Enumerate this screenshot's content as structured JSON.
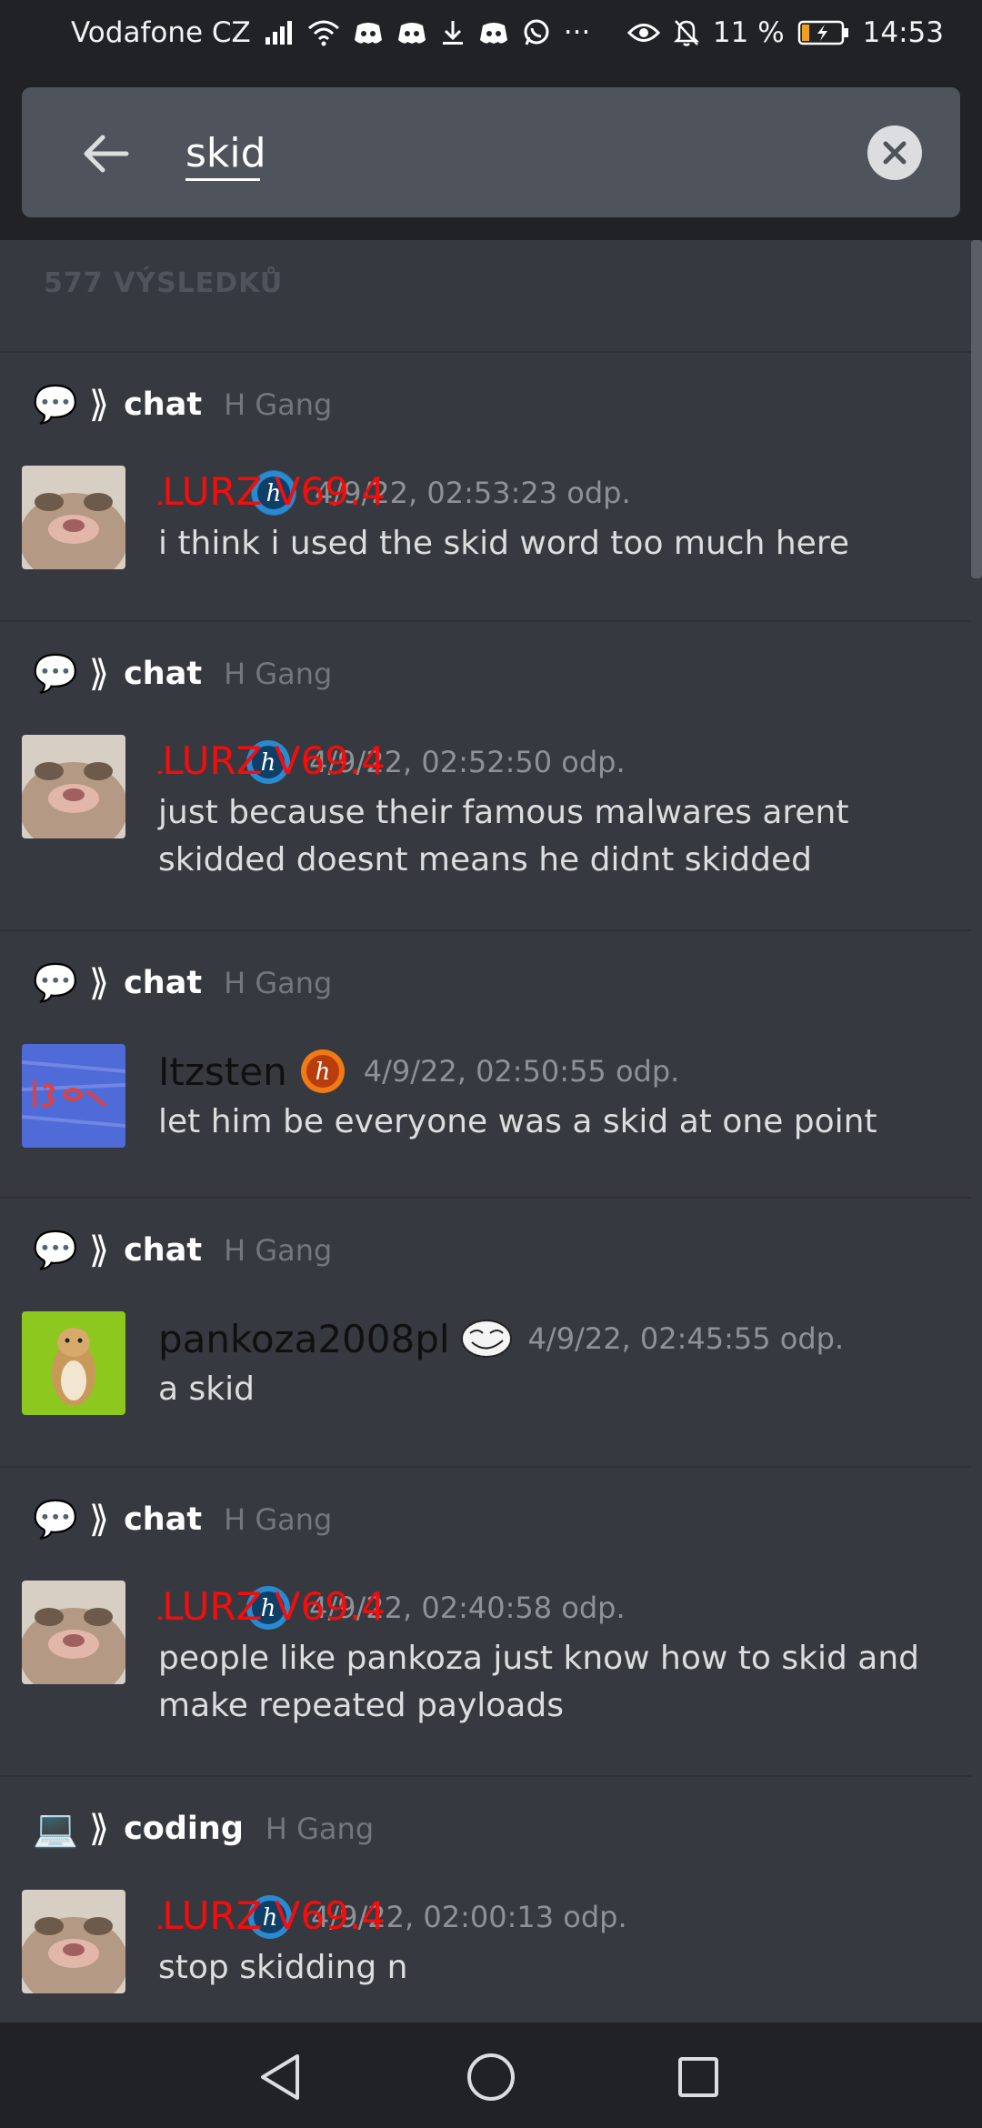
{
  "status_bar": {
    "carrier": "Vodafone CZ",
    "dots": "···",
    "battery_percent": "11 %",
    "time": "14:53",
    "icons": [
      "signal-icon",
      "wifi-icon",
      "discord-icon",
      "discord-icon",
      "download-icon",
      "discord-icon",
      "whatsapp-icon",
      "eye-icon",
      "bell-off-icon",
      "battery-icon"
    ]
  },
  "search": {
    "query": "skid",
    "back_icon": "arrow-left-icon",
    "clear_icon": "close-icon"
  },
  "results": {
    "count_label": "577 VÝSLEDKŮ",
    "items": [
      {
        "channel_emoji": "💬",
        "channel_arrow": "⟫",
        "channel": "chat",
        "guild": "H Gang",
        "author": "OT KILLURZ V69.4",
        "author_color": "#f30d0d",
        "badge": "h-badge-icon",
        "timestamp": "4/9/22, 02:53:23 odp.",
        "text": "i think i used the skid word too much here"
      },
      {
        "channel_emoji": "💬",
        "channel_arrow": "⟫",
        "channel": "chat",
        "guild": "H Gang",
        "author": "OT KILLURZ V69.4",
        "author_color": "#f30d0d",
        "badge": "h-badge-icon",
        "timestamp": "4/9/22, 02:52:50 odp.",
        "text": "just because their famous malwares arent skidded doesnt means he didnt skidded"
      },
      {
        "channel_emoji": "💬",
        "channel_arrow": "⟫",
        "channel": "chat",
        "guild": "H Gang",
        "author": "Itzsten",
        "author_color": "#101010",
        "badge": "h-badge-orange-icon",
        "timestamp": "4/9/22, 02:50:55 odp.",
        "text": "let him be everyone was a skid at one point"
      },
      {
        "channel_emoji": "💬",
        "channel_arrow": "⟫",
        "channel": "chat",
        "guild": "H Gang",
        "author": "pankoza2008pl",
        "author_color": "#101010",
        "badge": "trollface-badge-icon",
        "timestamp": "4/9/22, 02:45:55 odp.",
        "text": "a skid"
      },
      {
        "channel_emoji": "💬",
        "channel_arrow": "⟫",
        "channel": "chat",
        "guild": "H Gang",
        "author": "OT KILLURZ V69.4",
        "author_color": "#f30d0d",
        "badge": "h-badge-icon",
        "timestamp": "4/9/22, 02:40:58 odp.",
        "text": "people like pankoza just know how to skid and make repeated payloads"
      },
      {
        "channel_emoji": "💻",
        "channel_arrow": "⟫",
        "channel": "coding",
        "guild": "H Gang",
        "author": "OT KILLURZ V69.4",
        "author_color": "#f30d0d",
        "badge": "h-badge-icon",
        "timestamp": "4/9/22, 02:00:13 odp.",
        "text": "stop skidding n"
      }
    ]
  },
  "nav": {
    "back": "nav-back-icon",
    "home": "nav-home-icon",
    "recents": "nav-recents-icon"
  },
  "colors": {
    "background": "#36393f",
    "header": "#202225",
    "search_field": "#4f545c",
    "author_red": "#f30d0d"
  }
}
